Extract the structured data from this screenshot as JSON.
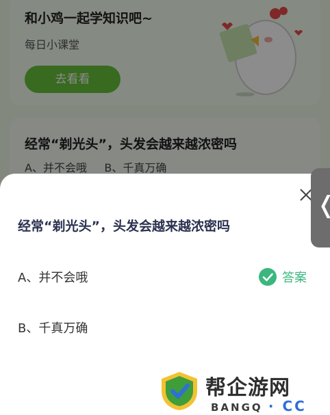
{
  "background": {
    "banner": {
      "title": "和小鸡一起学知识吧~",
      "subtitle": "每日小课堂",
      "button_label": "去看看"
    },
    "card": {
      "question": "经常“剃光头”，头发会越来越浓密吗",
      "options_text": "A、并不会哦     B、千真万确"
    }
  },
  "sheet": {
    "question": "经常“剃光头”，头发会越来越浓密吗",
    "options": [
      {
        "label": "A、并不会哦",
        "is_answer": true
      },
      {
        "label": "B、千真万确",
        "is_answer": false
      }
    ],
    "answer_tag": "答案",
    "close_icon": "close-icon"
  },
  "side_tab": {
    "glyph": "❬",
    "icon": "chevron-left-icon"
  },
  "watermark": {
    "name": "帮企游网",
    "domain_text": "BANGQ",
    "domain_suffix": "· CC"
  },
  "colors": {
    "accent_green": "#67c23a",
    "answer_green": "#3bb77e",
    "question_text": "#2b3250"
  }
}
